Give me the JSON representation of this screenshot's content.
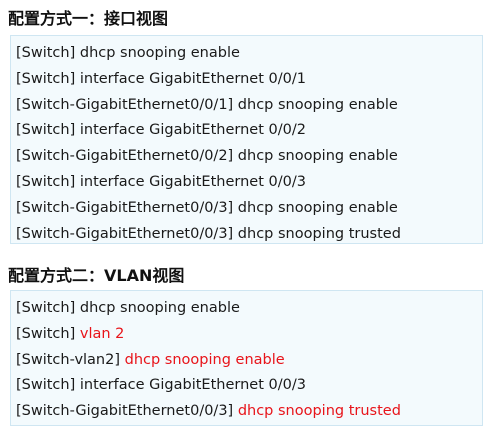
{
  "section1": {
    "title": "配置方式一：接口视图",
    "lines": [
      {
        "prefix": "[Switch] dhcp snooping enable",
        "highlight": ""
      },
      {
        "prefix": "[Switch] interface GigabitEthernet 0/0/1",
        "highlight": ""
      },
      {
        "prefix": "[Switch-GigabitEthernet0/0/1] dhcp snooping enable",
        "highlight": ""
      },
      {
        "prefix": "[Switch] interface GigabitEthernet 0/0/2",
        "highlight": ""
      },
      {
        "prefix": "[Switch-GigabitEthernet0/0/2] dhcp snooping enable",
        "highlight": ""
      },
      {
        "prefix": "[Switch] interface GigabitEthernet 0/0/3",
        "highlight": ""
      },
      {
        "prefix": "[Switch-GigabitEthernet0/0/3] dhcp snooping enable",
        "highlight": ""
      },
      {
        "prefix": "[Switch-GigabitEthernet0/0/3] dhcp snooping trusted",
        "highlight": ""
      }
    ]
  },
  "section2": {
    "title": "配置方式二：VLAN视图",
    "lines": [
      {
        "prefix": "[Switch] dhcp snooping enable",
        "highlight": ""
      },
      {
        "prefix": "[Switch] ",
        "highlight": "vlan 2"
      },
      {
        "prefix": "[Switch-vlan2] ",
        "highlight": "dhcp snooping enable"
      },
      {
        "prefix": "[Switch] interface GigabitEthernet 0/0/3",
        "highlight": ""
      },
      {
        "prefix": "[Switch-GigabitEthernet0/0/3] ",
        "highlight": "dhcp snooping trusted"
      }
    ]
  },
  "colors": {
    "highlight": "#e8141a",
    "box_background": "#f3fafd",
    "box_border": "#cfe6f2"
  }
}
